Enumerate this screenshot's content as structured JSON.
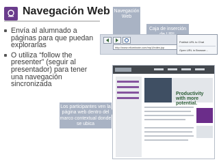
{
  "slide": {
    "title": "Navegación Web",
    "bullets": [
      "Envía al alumnado a páginas para que puedan explorarlas",
      "O utiliza “follow the presenter” (seguir al presentador) para tener una navegación sincronizada"
    ]
  },
  "callouts": {
    "navegacion": "Navegación Web",
    "caja": "Caja de inserción de URL",
    "participantes": "Los participantes ven la página web dentro del marco contextual donde se ubica"
  },
  "menu_items": [
    "Publish URL to Chat",
    "Open URL in Browser..."
  ],
  "url_value": "http://www.elluminate.com/mp1/index.jsp",
  "page_heading": "Productivity with more potential.",
  "icons": [
    "logo-icon",
    "back-icon",
    "forward-icon",
    "reload-icon",
    "go-icon"
  ]
}
